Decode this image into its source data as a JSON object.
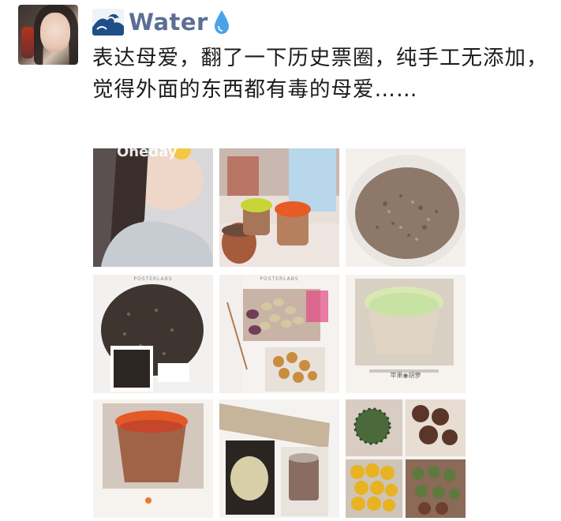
{
  "author": {
    "name": "Water",
    "avatar_icon": "user-avatar",
    "name_emoji_before": "wave-emoji",
    "name_emoji_after": "droplet-emoji"
  },
  "post": {
    "text": "表达母爱，翻了一下历史票圈，纯手工无添加，觉得外面的东西都有毒的母爱……"
  },
  "photos": {
    "p1": {
      "overlay_text": "Oneday"
    },
    "p4": {
      "header": "POSTERLABS"
    },
    "p5": {
      "header": "POSTERLABS"
    },
    "p6": {
      "caption": "苹果◉胡萝"
    }
  },
  "colors": {
    "name": "#5c6e94",
    "text": "#1b1b1b",
    "background": "#ffffff"
  }
}
